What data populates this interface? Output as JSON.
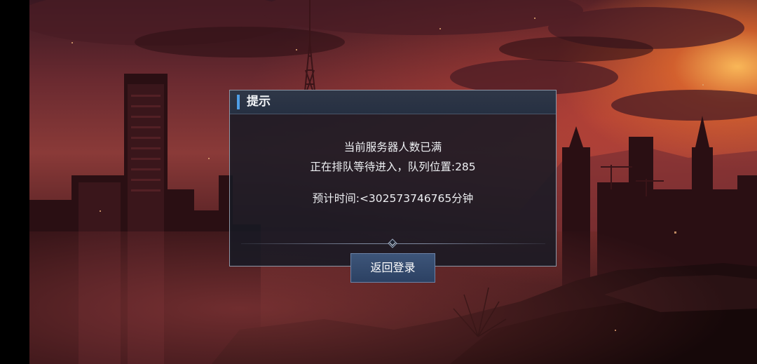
{
  "dialog": {
    "title": "提示",
    "message_line1": "当前服务器人数已满",
    "message_line2": "正在排队等待进入，队列位置:285",
    "message_line3": "预计时间:<302573746765分钟",
    "return_button_label": "返回登录"
  },
  "colors": {
    "header_accent": "#4f9fe8",
    "button_bg": "#34496d",
    "dialog_bg": "#161a24",
    "sky_glow": "#e8823a"
  }
}
